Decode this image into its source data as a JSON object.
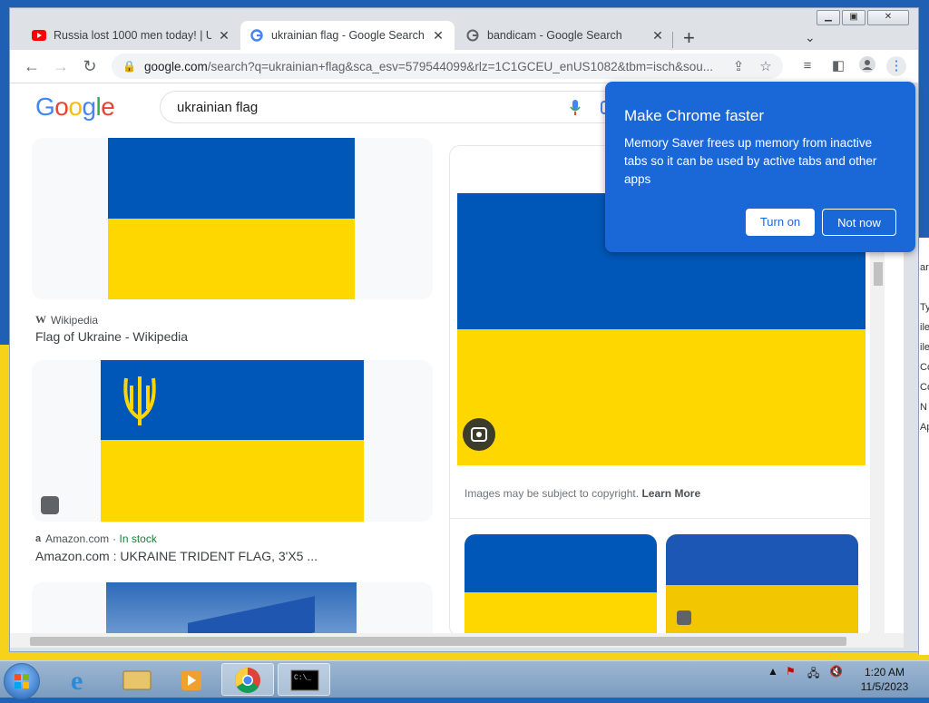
{
  "browser": {
    "tabs": [
      {
        "title": "Russia lost 1000 men today! | Uk",
        "favicon": "youtube-icon"
      },
      {
        "title": "ukrainian flag - Google Search",
        "favicon": "google-icon"
      },
      {
        "title": "bandicam - Google Search",
        "favicon": "google-icon"
      }
    ],
    "url_host": "google.com",
    "url_path": "/search?q=ukrainian+flag&sca_esv=579544099&rlz=1C1GCEU_enUS1082&tbm=isch&sou..."
  },
  "google": {
    "logo": "Google",
    "query": "ukrainian flag"
  },
  "results": [
    {
      "source": "Wikipedia",
      "title": "Flag of Ukraine - Wikipedia"
    },
    {
      "source": "Amazon.com",
      "stock": "· In stock",
      "title": "Amazon.com : UKRAINE TRIDENT FLAG, 3'X5 ..."
    }
  ],
  "panel": {
    "copyright": "Images may be subject to copyright.",
    "learn_more": "Learn More"
  },
  "popup": {
    "title": "Make Chrome faster",
    "body": "Memory Saver frees up memory from inactive tabs so it can be used by active tabs and other apps",
    "turn_on": "Turn on",
    "not_now": "Not now"
  },
  "taskbar": {
    "time": "1:20 AM",
    "date": "11/5/2023"
  },
  "colors": {
    "flag_blue": "#0057b7",
    "flag_yellow": "#ffd700",
    "popup_bg": "#1a68d8"
  }
}
